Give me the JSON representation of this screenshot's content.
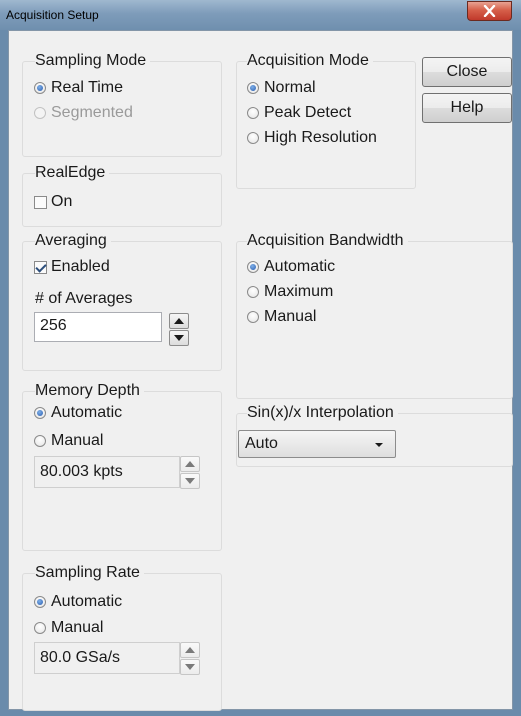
{
  "window": {
    "title": "Acquisition Setup"
  },
  "buttons": {
    "close": "Close",
    "help": "Help"
  },
  "sampling_mode": {
    "label": "Sampling Mode",
    "options": [
      {
        "label": "Real Time",
        "checked": true,
        "enabled": true
      },
      {
        "label": "Segmented",
        "checked": false,
        "enabled": false
      }
    ]
  },
  "realedge": {
    "label": "RealEdge",
    "checkbox": {
      "label": "On",
      "checked": false
    }
  },
  "averaging": {
    "label": "Averaging",
    "enabled_checkbox": {
      "label": "Enabled",
      "checked": true
    },
    "count_label": "# of Averages",
    "count_value": "256"
  },
  "memory_depth": {
    "label": "Memory Depth",
    "options": [
      {
        "label": "Automatic",
        "checked": true
      },
      {
        "label": "Manual",
        "checked": false
      }
    ],
    "value": "80.003 kpts"
  },
  "sampling_rate": {
    "label": "Sampling Rate",
    "options": [
      {
        "label": "Automatic",
        "checked": true
      },
      {
        "label": "Manual",
        "checked": false
      }
    ],
    "value": "80.0 GSa/s"
  },
  "acquisition_mode": {
    "label": "Acquisition Mode",
    "options": [
      {
        "label": "Normal",
        "checked": true
      },
      {
        "label": "Peak Detect",
        "checked": false
      },
      {
        "label": "High Resolution",
        "checked": false
      }
    ]
  },
  "acquisition_bandwidth": {
    "label": "Acquisition Bandwidth",
    "options": [
      {
        "label": "Automatic",
        "checked": true
      },
      {
        "label": "Maximum",
        "checked": false
      },
      {
        "label": "Manual",
        "checked": false
      }
    ]
  },
  "interpolation": {
    "label": "Sin(x)/x Interpolation",
    "selected": "Auto"
  },
  "colors": {
    "title_bar": "#7e9cba",
    "close_button": "#c0392b",
    "radio_checked": "#2a5db0"
  },
  "icons": {
    "window_close": "close-icon",
    "spin_up": "triangle-up-icon",
    "spin_down": "triangle-down-icon",
    "dropdown": "chevron-down-icon"
  }
}
